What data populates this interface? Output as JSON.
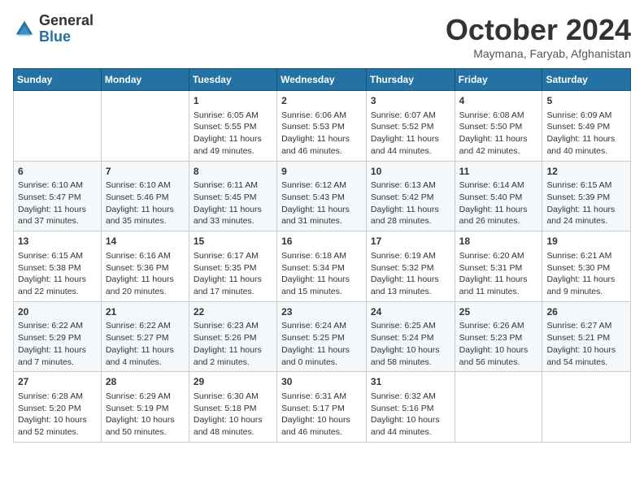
{
  "logo": {
    "general": "General",
    "blue": "Blue"
  },
  "title": "October 2024",
  "subtitle": "Maymana, Faryab, Afghanistan",
  "days_of_week": [
    "Sunday",
    "Monday",
    "Tuesday",
    "Wednesday",
    "Thursday",
    "Friday",
    "Saturday"
  ],
  "weeks": [
    [
      {
        "day": "",
        "content": ""
      },
      {
        "day": "",
        "content": ""
      },
      {
        "day": "1",
        "content": "Sunrise: 6:05 AM\nSunset: 5:55 PM\nDaylight: 11 hours and 49 minutes."
      },
      {
        "day": "2",
        "content": "Sunrise: 6:06 AM\nSunset: 5:53 PM\nDaylight: 11 hours and 46 minutes."
      },
      {
        "day": "3",
        "content": "Sunrise: 6:07 AM\nSunset: 5:52 PM\nDaylight: 11 hours and 44 minutes."
      },
      {
        "day": "4",
        "content": "Sunrise: 6:08 AM\nSunset: 5:50 PM\nDaylight: 11 hours and 42 minutes."
      },
      {
        "day": "5",
        "content": "Sunrise: 6:09 AM\nSunset: 5:49 PM\nDaylight: 11 hours and 40 minutes."
      }
    ],
    [
      {
        "day": "6",
        "content": "Sunrise: 6:10 AM\nSunset: 5:47 PM\nDaylight: 11 hours and 37 minutes."
      },
      {
        "day": "7",
        "content": "Sunrise: 6:10 AM\nSunset: 5:46 PM\nDaylight: 11 hours and 35 minutes."
      },
      {
        "day": "8",
        "content": "Sunrise: 6:11 AM\nSunset: 5:45 PM\nDaylight: 11 hours and 33 minutes."
      },
      {
        "day": "9",
        "content": "Sunrise: 6:12 AM\nSunset: 5:43 PM\nDaylight: 11 hours and 31 minutes."
      },
      {
        "day": "10",
        "content": "Sunrise: 6:13 AM\nSunset: 5:42 PM\nDaylight: 11 hours and 28 minutes."
      },
      {
        "day": "11",
        "content": "Sunrise: 6:14 AM\nSunset: 5:40 PM\nDaylight: 11 hours and 26 minutes."
      },
      {
        "day": "12",
        "content": "Sunrise: 6:15 AM\nSunset: 5:39 PM\nDaylight: 11 hours and 24 minutes."
      }
    ],
    [
      {
        "day": "13",
        "content": "Sunrise: 6:15 AM\nSunset: 5:38 PM\nDaylight: 11 hours and 22 minutes."
      },
      {
        "day": "14",
        "content": "Sunrise: 6:16 AM\nSunset: 5:36 PM\nDaylight: 11 hours and 20 minutes."
      },
      {
        "day": "15",
        "content": "Sunrise: 6:17 AM\nSunset: 5:35 PM\nDaylight: 11 hours and 17 minutes."
      },
      {
        "day": "16",
        "content": "Sunrise: 6:18 AM\nSunset: 5:34 PM\nDaylight: 11 hours and 15 minutes."
      },
      {
        "day": "17",
        "content": "Sunrise: 6:19 AM\nSunset: 5:32 PM\nDaylight: 11 hours and 13 minutes."
      },
      {
        "day": "18",
        "content": "Sunrise: 6:20 AM\nSunset: 5:31 PM\nDaylight: 11 hours and 11 minutes."
      },
      {
        "day": "19",
        "content": "Sunrise: 6:21 AM\nSunset: 5:30 PM\nDaylight: 11 hours and 9 minutes."
      }
    ],
    [
      {
        "day": "20",
        "content": "Sunrise: 6:22 AM\nSunset: 5:29 PM\nDaylight: 11 hours and 7 minutes."
      },
      {
        "day": "21",
        "content": "Sunrise: 6:22 AM\nSunset: 5:27 PM\nDaylight: 11 hours and 4 minutes."
      },
      {
        "day": "22",
        "content": "Sunrise: 6:23 AM\nSunset: 5:26 PM\nDaylight: 11 hours and 2 minutes."
      },
      {
        "day": "23",
        "content": "Sunrise: 6:24 AM\nSunset: 5:25 PM\nDaylight: 11 hours and 0 minutes."
      },
      {
        "day": "24",
        "content": "Sunrise: 6:25 AM\nSunset: 5:24 PM\nDaylight: 10 hours and 58 minutes."
      },
      {
        "day": "25",
        "content": "Sunrise: 6:26 AM\nSunset: 5:23 PM\nDaylight: 10 hours and 56 minutes."
      },
      {
        "day": "26",
        "content": "Sunrise: 6:27 AM\nSunset: 5:21 PM\nDaylight: 10 hours and 54 minutes."
      }
    ],
    [
      {
        "day": "27",
        "content": "Sunrise: 6:28 AM\nSunset: 5:20 PM\nDaylight: 10 hours and 52 minutes."
      },
      {
        "day": "28",
        "content": "Sunrise: 6:29 AM\nSunset: 5:19 PM\nDaylight: 10 hours and 50 minutes."
      },
      {
        "day": "29",
        "content": "Sunrise: 6:30 AM\nSunset: 5:18 PM\nDaylight: 10 hours and 48 minutes."
      },
      {
        "day": "30",
        "content": "Sunrise: 6:31 AM\nSunset: 5:17 PM\nDaylight: 10 hours and 46 minutes."
      },
      {
        "day": "31",
        "content": "Sunrise: 6:32 AM\nSunset: 5:16 PM\nDaylight: 10 hours and 44 minutes."
      },
      {
        "day": "",
        "content": ""
      },
      {
        "day": "",
        "content": ""
      }
    ]
  ]
}
